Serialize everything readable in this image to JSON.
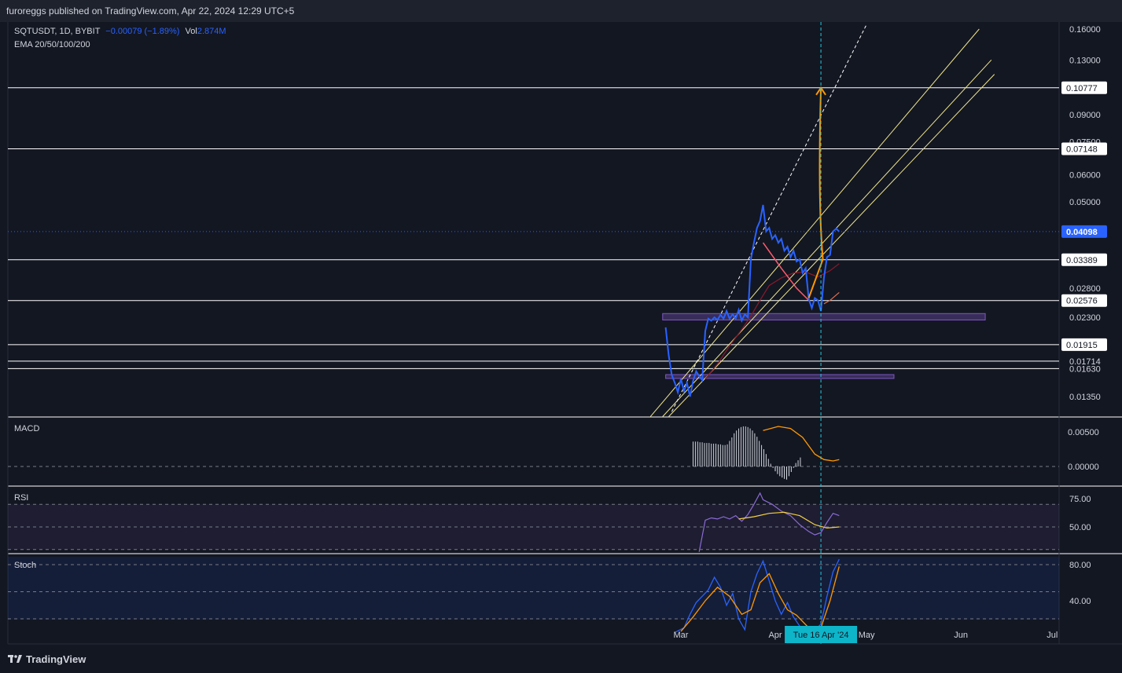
{
  "header": {
    "publish_text": "furoreggs published on TradingView.com, Apr 22, 2024 12:29 UTC+5"
  },
  "legend": {
    "symbol": "SQTUSDT, 1D, BYBIT",
    "change": "−0.00079 (−1.89%)",
    "vol_label": "Vol",
    "vol_value": "2.874M",
    "ema": "EMA 20/50/100/200"
  },
  "panes": {
    "macd": "MACD",
    "rsi": "RSI",
    "stoch": "Stoch"
  },
  "footer": {
    "logo_text": "TradingView"
  },
  "colors": {
    "background": "#131722",
    "price_line": "#2962ff",
    "channel": "#f0e68c",
    "projection": "#ff9800",
    "zone": "#7e57c2",
    "crosshair": "#26c6da",
    "horizontal": "#ffffff",
    "rsi": "#7e57c2",
    "stoch_k": "#2962ff",
    "stoch_d": "#ff9800"
  },
  "chart_data": {
    "type": "line",
    "symbol": "SQTUSDT",
    "scale": "log",
    "price_axis_ticks": [
      "0.16000",
      "0.13000",
      "0.10777",
      "0.09000",
      "0.07500",
      "0.07148",
      "0.06000",
      "0.05000",
      "0.04098",
      "0.03389",
      "0.02800",
      "0.02576",
      "0.02300",
      "0.01915",
      "0.01714",
      "0.01630",
      "0.01350"
    ],
    "time_axis_ticks": [
      "Mar",
      "Apr",
      "Tue 16 Apr '24",
      "May",
      "Jun",
      "Jul"
    ],
    "series": [
      {
        "name": "SQTUSDT",
        "points": [
          [
            "2024-02-25",
            0.0215
          ],
          [
            "2024-02-26",
            0.0178
          ],
          [
            "2024-02-27",
            0.0156
          ],
          [
            "2024-02-28",
            0.0148
          ],
          [
            "2024-02-29",
            0.0139
          ],
          [
            "2024-03-01",
            0.0152
          ],
          [
            "2024-03-02",
            0.014
          ],
          [
            "2024-03-03",
            0.0148
          ],
          [
            "2024-03-04",
            0.0135
          ],
          [
            "2024-03-05",
            0.015
          ],
          [
            "2024-03-06",
            0.016
          ],
          [
            "2024-03-07",
            0.0155
          ],
          [
            "2024-03-08",
            0.0151
          ],
          [
            "2024-03-09",
            0.021
          ],
          [
            "2024-03-10",
            0.0228
          ],
          [
            "2024-03-11",
            0.0225
          ],
          [
            "2024-03-12",
            0.023
          ],
          [
            "2024-03-13",
            0.0226
          ],
          [
            "2024-03-14",
            0.0234
          ],
          [
            "2024-03-15",
            0.0228
          ],
          [
            "2024-03-16",
            0.024
          ],
          [
            "2024-03-17",
            0.0228
          ],
          [
            "2024-03-18",
            0.0235
          ],
          [
            "2024-03-19",
            0.0228
          ],
          [
            "2024-03-20",
            0.0242
          ],
          [
            "2024-03-21",
            0.0225
          ],
          [
            "2024-03-22",
            0.0235
          ],
          [
            "2024-03-23",
            0.023
          ],
          [
            "2024-03-24",
            0.034
          ],
          [
            "2024-03-25",
            0.038
          ],
          [
            "2024-03-26",
            0.042
          ],
          [
            "2024-03-27",
            0.044
          ],
          [
            "2024-03-28",
            0.049
          ],
          [
            "2024-03-29",
            0.041
          ],
          [
            "2024-03-30",
            0.042
          ],
          [
            "2024-03-31",
            0.039
          ],
          [
            "2024-04-01",
            0.04
          ],
          [
            "2024-04-02",
            0.038
          ],
          [
            "2024-04-03",
            0.039
          ],
          [
            "2024-04-04",
            0.036
          ],
          [
            "2024-04-05",
            0.037
          ],
          [
            "2024-04-06",
            0.0345
          ],
          [
            "2024-04-07",
            0.036
          ],
          [
            "2024-04-08",
            0.0335
          ],
          [
            "2024-04-09",
            0.034
          ],
          [
            "2024-04-10",
            0.031
          ],
          [
            "2024-04-11",
            0.032
          ],
          [
            "2024-04-12",
            0.026
          ],
          [
            "2024-04-13",
            0.0245
          ],
          [
            "2024-04-14",
            0.0262
          ],
          [
            "2024-04-15",
            0.0258
          ],
          [
            "2024-04-16",
            0.024
          ],
          [
            "2024-04-17",
            0.03
          ],
          [
            "2024-04-18",
            0.0345
          ],
          [
            "2024-04-19",
            0.035
          ],
          [
            "2024-04-20",
            0.041
          ],
          [
            "2024-04-21",
            0.0418
          ],
          [
            "2024-04-22",
            0.04098
          ]
        ]
      },
      {
        "name": "",
        "points": [
          [
            "2024-03-09",
            0.0152
          ],
          [
            "2024-03-13",
            0.0168
          ],
          [
            "2024-03-17",
            0.019
          ],
          [
            "2024-03-21",
            0.0212
          ],
          [
            "2024-03-24",
            0.0232
          ],
          [
            "2024-03-27",
            0.0258
          ],
          [
            "2024-03-30",
            0.0285
          ],
          [
            "2024-04-03",
            0.03
          ],
          [
            "2024-04-07",
            0.031
          ],
          [
            "2024-04-11",
            0.0312
          ],
          [
            "2024-04-15",
            0.0302
          ],
          [
            "2024-04-19",
            0.0315
          ],
          [
            "2024-04-22",
            0.033
          ]
        ]
      },
      {
        "name": "",
        "points": [
          [
            "2024-04-17",
            0.0252
          ],
          [
            "2024-04-19",
            0.0258
          ],
          [
            "2024-04-22",
            0.0272
          ]
        ]
      }
    ],
    "horizontal_levels": [
      0.10777,
      0.07148,
      0.03389,
      0.02576,
      0.01915,
      0.01714,
      0.0163
    ],
    "ascending_channel": {
      "lines": [
        [
          [
            "2024-02-20",
            0.0118
          ],
          [
            "2024-06-07",
            0.16
          ]
        ],
        [
          [
            "2024-02-24",
            0.0118
          ],
          [
            "2024-06-11",
            0.13
          ]
        ],
        [
          [
            "2024-02-26",
            0.0118
          ],
          [
            "2024-06-12",
            0.118
          ]
        ]
      ],
      "dashed_line": [
        [
          "2024-02-27",
          0.0122
        ],
        [
          "2024-05-01",
          0.165
        ]
      ]
    },
    "projection_arrow": {
      "from": [
        "2024-04-12",
        0.0262
      ],
      "to": [
        "2024-04-16",
        0.10777
      ]
    },
    "curve_annotation": [
      [
        "2024-03-28",
        0.038
      ],
      [
        "2024-04-03",
        0.032
      ],
      [
        "2024-04-08",
        0.028
      ],
      [
        "2024-04-12",
        0.0258
      ]
    ],
    "zones": [
      {
        "from": "2024-02-24",
        "to": "2024-06-09",
        "low": 0.0226,
        "high": 0.0236
      },
      {
        "from": "2024-02-25",
        "to": "2024-05-10",
        "low": 0.01525,
        "high": 0.01565
      }
    ],
    "crosshair_date": "2024-04-16",
    "current_price": 0.04098,
    "macd": {
      "ticks": [
        "0.00500",
        "0.00000"
      ],
      "histogram": [
        0.0036,
        0.0036,
        0.0036,
        0.0035,
        0.0035,
        0.0034,
        0.0034,
        0.0034,
        0.0033,
        0.0033,
        0.0033,
        0.0032,
        0.0032,
        0.0031,
        0.0031,
        0.0032,
        0.0037,
        0.0042,
        0.0048,
        0.0052,
        0.0055,
        0.0057,
        0.0058,
        0.0058,
        0.0057,
        0.0055,
        0.0052,
        0.0048,
        0.0043,
        0.0037,
        0.0031,
        0.0025,
        0.0018,
        0.0011,
        0.0004,
        -0.0002,
        -0.0007,
        -0.0011,
        -0.0014,
        -0.0016,
        -0.0018,
        -0.0019,
        -0.0014,
        -0.0008,
        -0.0002,
        0.0005,
        0.0009,
        0.0013
      ],
      "hist_start": "2024-03-05",
      "signal": [
        [
          "2024-03-28",
          0.0052
        ],
        [
          "2024-04-02",
          0.0058
        ],
        [
          "2024-04-06",
          0.0055
        ],
        [
          "2024-04-10",
          0.0042
        ],
        [
          "2024-04-14",
          0.0018
        ],
        [
          "2024-04-17",
          0.001
        ],
        [
          "2024-04-20",
          0.0008
        ],
        [
          "2024-04-22",
          0.001
        ]
      ]
    },
    "rsi": {
      "ticks": [
        "75.00",
        "50.00"
      ],
      "bands": [
        70,
        30
      ],
      "values": [
        [
          "2024-03-07",
          28
        ],
        [
          "2024-03-09",
          56
        ],
        [
          "2024-03-11",
          58
        ],
        [
          "2024-03-13",
          57
        ],
        [
          "2024-03-15",
          59
        ],
        [
          "2024-03-17",
          57
        ],
        [
          "2024-03-19",
          60
        ],
        [
          "2024-03-21",
          55
        ],
        [
          "2024-03-23",
          61
        ],
        [
          "2024-03-25",
          70
        ],
        [
          "2024-03-27",
          80
        ],
        [
          "2024-03-28",
          74
        ],
        [
          "2024-03-31",
          70
        ],
        [
          "2024-04-03",
          64
        ],
        [
          "2024-04-06",
          60
        ],
        [
          "2024-04-09",
          52
        ],
        [
          "2024-04-12",
          46
        ],
        [
          "2024-04-14",
          43
        ],
        [
          "2024-04-16",
          45
        ],
        [
          "2024-04-18",
          54
        ],
        [
          "2024-04-20",
          62
        ],
        [
          "2024-04-22",
          60
        ]
      ],
      "ma": [
        [
          "2024-03-20",
          57
        ],
        [
          "2024-03-25",
          59
        ],
        [
          "2024-03-30",
          62
        ],
        [
          "2024-04-04",
          63
        ],
        [
          "2024-04-09",
          60
        ],
        [
          "2024-04-14",
          52
        ],
        [
          "2024-04-18",
          49
        ],
        [
          "2024-04-22",
          50
        ]
      ]
    },
    "stoch": {
      "ticks": [
        "80.00",
        "40.00"
      ],
      "bands": [
        80,
        20
      ],
      "k": [
        [
          "2024-02-28",
          5
        ],
        [
          "2024-03-02",
          10
        ],
        [
          "2024-03-04",
          25
        ],
        [
          "2024-03-06",
          38
        ],
        [
          "2024-03-08",
          45
        ],
        [
          "2024-03-10",
          52
        ],
        [
          "2024-03-12",
          66
        ],
        [
          "2024-03-14",
          55
        ],
        [
          "2024-03-16",
          35
        ],
        [
          "2024-03-18",
          48
        ],
        [
          "2024-03-20",
          20
        ],
        [
          "2024-03-22",
          8
        ],
        [
          "2024-03-24",
          50
        ],
        [
          "2024-03-26",
          70
        ],
        [
          "2024-03-28",
          84
        ],
        [
          "2024-03-30",
          62
        ],
        [
          "2024-04-01",
          40
        ],
        [
          "2024-04-03",
          25
        ],
        [
          "2024-04-05",
          38
        ],
        [
          "2024-04-07",
          22
        ],
        [
          "2024-04-09",
          12
        ],
        [
          "2024-04-12",
          6
        ],
        [
          "2024-04-14",
          8
        ],
        [
          "2024-04-16",
          14
        ],
        [
          "2024-04-18",
          45
        ],
        [
          "2024-04-20",
          72
        ],
        [
          "2024-04-22",
          86
        ]
      ],
      "d": [
        [
          "2024-03-01",
          6
        ],
        [
          "2024-03-05",
          22
        ],
        [
          "2024-03-09",
          40
        ],
        [
          "2024-03-13",
          55
        ],
        [
          "2024-03-17",
          45
        ],
        [
          "2024-03-21",
          25
        ],
        [
          "2024-03-24",
          30
        ],
        [
          "2024-03-27",
          60
        ],
        [
          "2024-03-30",
          70
        ],
        [
          "2024-04-02",
          48
        ],
        [
          "2024-04-05",
          30
        ],
        [
          "2024-04-08",
          24
        ],
        [
          "2024-04-12",
          10
        ],
        [
          "2024-04-16",
          10
        ],
        [
          "2024-04-19",
          40
        ],
        [
          "2024-04-22",
          78
        ]
      ]
    }
  }
}
